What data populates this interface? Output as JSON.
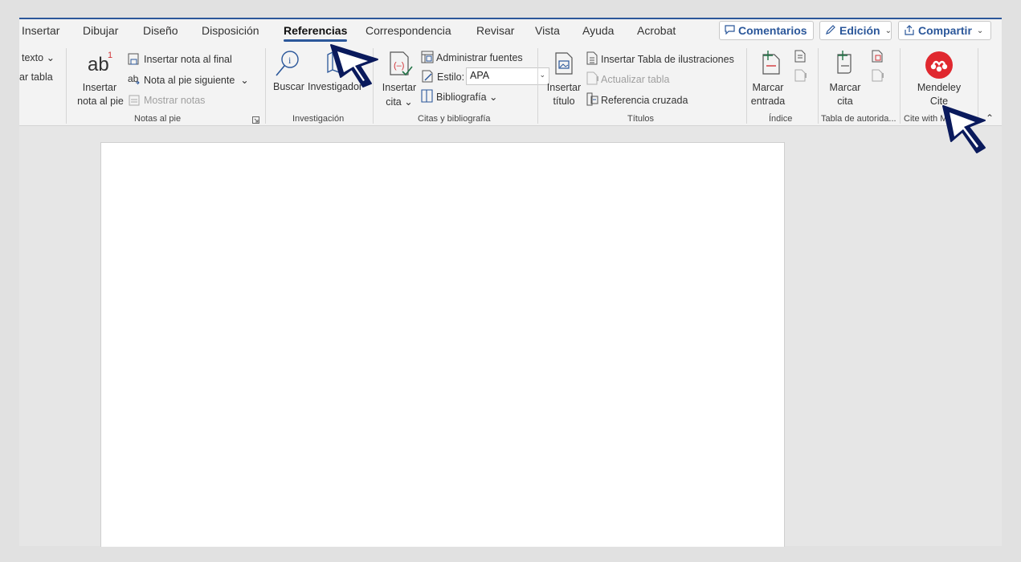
{
  "tabs": [
    "Insertar",
    "Dibujar",
    "Diseño",
    "Disposición",
    "Referencias",
    "Correspondencia",
    "Revisar",
    "Vista",
    "Ayuda",
    "Acrobat"
  ],
  "actions": {
    "comments": "Comentarios",
    "editing": "Edición",
    "share": "Compartir"
  },
  "toc": {
    "text": "texto",
    "table": "ar tabla"
  },
  "footnotes": {
    "insert_line1": "Insertar",
    "insert_line2": "nota al pie",
    "endnote": "Insertar nota al final",
    "next": "Nota al pie siguiente",
    "show": "Mostrar notas",
    "group": "Notas al pie"
  },
  "research": {
    "search": "Buscar",
    "researcher": "Investigador",
    "group": "Investigación"
  },
  "citations": {
    "insert_line1": "Insertar",
    "insert_line2": "cita",
    "manage": "Administrar fuentes",
    "style_label": "Estilo:",
    "style_value": "APA",
    "bibliography": "Bibliografía",
    "group": "Citas y bibliografía"
  },
  "captions": {
    "insert_line1": "Insertar",
    "insert_line2": "título",
    "table_of_figures": "Insertar Tabla de ilustraciones",
    "update": "Actualizar tabla",
    "crossref": "Referencia cruzada",
    "group": "Títulos"
  },
  "index": {
    "mark_line1": "Marcar",
    "mark_line2": "entrada",
    "group": "Índice"
  },
  "authorities": {
    "mark_line1": "Marcar",
    "mark_line2": "cita",
    "group": "Tabla de autorida..."
  },
  "mendeley": {
    "line1": "Mendeley",
    "line2": "Cite",
    "group": "Cite with M"
  },
  "colors": {
    "accent": "#2b579a",
    "mendeley": "#e0282f",
    "cursor": "#0a1a5c"
  }
}
